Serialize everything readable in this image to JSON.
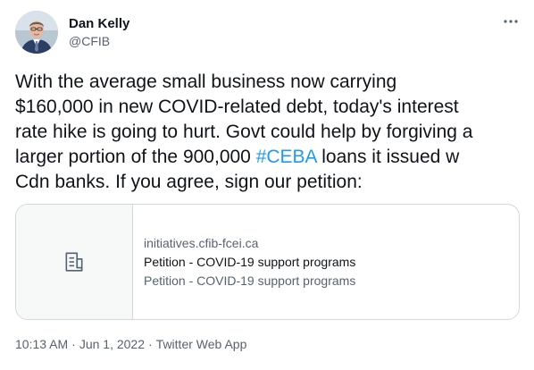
{
  "author": {
    "display_name": "Dan Kelly",
    "handle": "@CFIB"
  },
  "tweet": {
    "lines": [
      "With the average small business now carrying",
      "$160,000 in new COVID-related debt, today's interest",
      "rate hike is going to hurt. Govt could help by forgiving a"
    ],
    "line4_before": "larger portion of the 900,000 ",
    "hashtag": "#CEBA",
    "line4_after": " loans it issued w",
    "line5": "Cdn banks. If you agree, sign our petition:"
  },
  "link_card": {
    "domain": "initiatives.cfib-fcei.ca",
    "title": "Petition - COVID-19 support programs",
    "description": "Petition - COVID-19 support programs",
    "thumbnail_icon": "document-icon"
  },
  "meta": {
    "time": "10:13 AM",
    "separator": "·",
    "date": "Jun 1, 2022",
    "source": "Twitter Web App"
  },
  "colors": {
    "accent": "#1d9bf0",
    "text": "#0f1419",
    "secondary": "#536471",
    "border": "#cfd9de"
  }
}
